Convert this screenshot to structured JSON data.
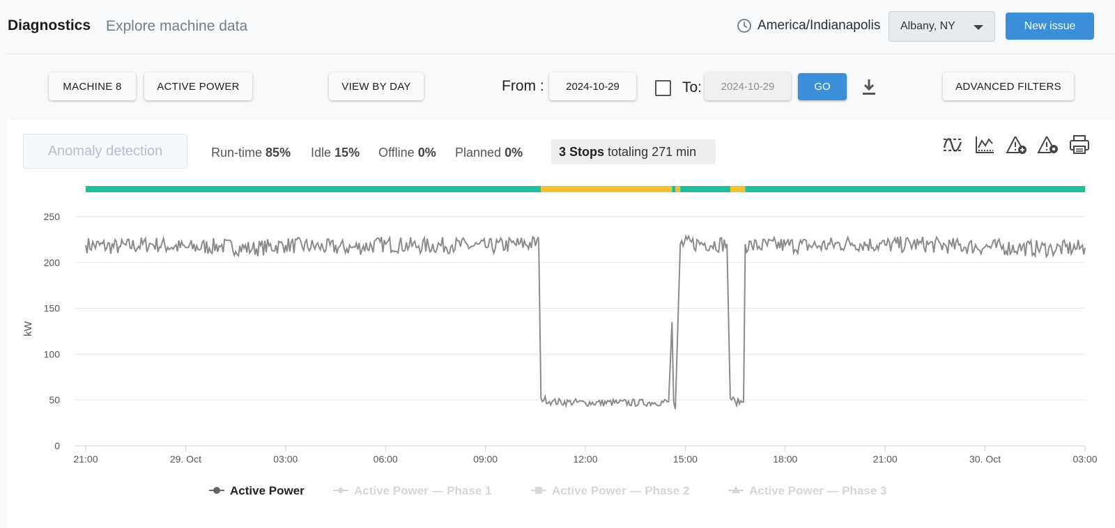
{
  "header": {
    "title": "Diagnostics",
    "subtitle": "Explore machine data",
    "timezone": "America/Indianapolis",
    "site": "Albany, NY",
    "new_issue_label": "New issue"
  },
  "toolbar": {
    "machine_label": "MACHINE 8",
    "metric_label": "ACTIVE POWER",
    "view_label": "VIEW BY DAY",
    "from_label": "From :",
    "from_date": "2024-10-29",
    "to_label": "To:",
    "to_date": "2024-10-29",
    "go_label": "GO",
    "advanced_label": "ADVANCED FILTERS"
  },
  "summary": {
    "anomaly_label": "Anomaly detection",
    "runtime_label": "Run-time",
    "runtime_value": "85%",
    "idle_label": "Idle",
    "idle_value": "15%",
    "offline_label": "Offline",
    "offline_value": "0%",
    "planned_label": "Planned",
    "planned_value": "0%",
    "stops_count": "3 Stops",
    "stops_text": "totaling 271 min"
  },
  "colors": {
    "running": "#1ebf99",
    "idle": "#f0c132",
    "series": "#8a8a8a",
    "accent": "#3b8fd9"
  },
  "chart_data": {
    "type": "line",
    "ylabel": "kW",
    "ylim": [
      0,
      250
    ],
    "yticks": [
      0,
      50,
      100,
      150,
      200,
      250
    ],
    "xlim": [
      "2024-10-28T21:00",
      "2024-10-30T03:00"
    ],
    "xticks": [
      {
        "t": "2024-10-28T21:00",
        "label": "21:00"
      },
      {
        "t": "2024-10-29T00:00",
        "label": "29. Oct"
      },
      {
        "t": "2024-10-29T03:00",
        "label": "03:00"
      },
      {
        "t": "2024-10-29T06:00",
        "label": "06:00"
      },
      {
        "t": "2024-10-29T09:00",
        "label": "09:00"
      },
      {
        "t": "2024-10-29T12:00",
        "label": "12:00"
      },
      {
        "t": "2024-10-29T15:00",
        "label": "15:00"
      },
      {
        "t": "2024-10-29T18:00",
        "label": "18:00"
      },
      {
        "t": "2024-10-29T21:00",
        "label": "21:00"
      },
      {
        "t": "2024-10-30T00:00",
        "label": "30. Oct"
      },
      {
        "t": "2024-10-30T03:00",
        "label": "03:00"
      }
    ],
    "state_timeline": [
      {
        "start": "2024-10-28T21:00",
        "end": "2024-10-29T10:40",
        "state": "running"
      },
      {
        "start": "2024-10-29T10:40",
        "end": "2024-10-29T14:36",
        "state": "idle"
      },
      {
        "start": "2024-10-29T14:36",
        "end": "2024-10-29T14:42",
        "state": "running"
      },
      {
        "start": "2024-10-29T14:42",
        "end": "2024-10-29T14:51",
        "state": "idle"
      },
      {
        "start": "2024-10-29T14:51",
        "end": "2024-10-29T16:21",
        "state": "running"
      },
      {
        "start": "2024-10-29T16:21",
        "end": "2024-10-29T16:48",
        "state": "idle"
      },
      {
        "start": "2024-10-29T16:48",
        "end": "2024-10-30T03:00",
        "state": "running"
      }
    ],
    "series": [
      {
        "name": "Active Power",
        "active": true,
        "points": [
          [
            "2024-10-28T21:00",
            219
          ],
          [
            "2024-10-28T22:00",
            217
          ],
          [
            "2024-10-28T23:00",
            220
          ],
          [
            "2024-10-29T00:00",
            216
          ],
          [
            "2024-10-29T01:00",
            218
          ],
          [
            "2024-10-29T02:00",
            215
          ],
          [
            "2024-10-29T03:00",
            219
          ],
          [
            "2024-10-29T04:00",
            217
          ],
          [
            "2024-10-29T05:00",
            216
          ],
          [
            "2024-10-29T06:00",
            220
          ],
          [
            "2024-10-29T07:00",
            218
          ],
          [
            "2024-10-29T08:00",
            219
          ],
          [
            "2024-10-29T09:00",
            217
          ],
          [
            "2024-10-29T10:00",
            220
          ],
          [
            "2024-10-29T10:36",
            221
          ],
          [
            "2024-10-29T10:40",
            52
          ],
          [
            "2024-10-29T11:00",
            48
          ],
          [
            "2024-10-29T12:00",
            47
          ],
          [
            "2024-10-29T13:00",
            47
          ],
          [
            "2024-10-29T14:00",
            47
          ],
          [
            "2024-10-29T14:30",
            48
          ],
          [
            "2024-10-29T14:36",
            135
          ],
          [
            "2024-10-29T14:39",
            48
          ],
          [
            "2024-10-29T14:42",
            40
          ],
          [
            "2024-10-29T14:51",
            220
          ],
          [
            "2024-10-29T15:30",
            221
          ],
          [
            "2024-10-29T16:15",
            220
          ],
          [
            "2024-10-29T16:21",
            52
          ],
          [
            "2024-10-29T16:30",
            48
          ],
          [
            "2024-10-29T16:45",
            48
          ],
          [
            "2024-10-29T16:48",
            220
          ],
          [
            "2024-10-29T17:00",
            218
          ],
          [
            "2024-10-29T18:00",
            219
          ],
          [
            "2024-10-29T19:00",
            218
          ],
          [
            "2024-10-29T20:00",
            221
          ],
          [
            "2024-10-29T21:00",
            219
          ],
          [
            "2024-10-29T22:00",
            220
          ],
          [
            "2024-10-29T23:00",
            218
          ],
          [
            "2024-10-30T00:00",
            217
          ],
          [
            "2024-10-30T01:00",
            216
          ],
          [
            "2024-10-30T02:00",
            215
          ],
          [
            "2024-10-30T03:00",
            216
          ]
        ]
      },
      {
        "name": "Active Power — Phase 1",
        "active": false,
        "marker": "diamond",
        "points": []
      },
      {
        "name": "Active Power — Phase 2",
        "active": false,
        "marker": "square",
        "points": []
      },
      {
        "name": "Active Power — Phase 3",
        "active": false,
        "marker": "triangle",
        "points": []
      }
    ]
  }
}
